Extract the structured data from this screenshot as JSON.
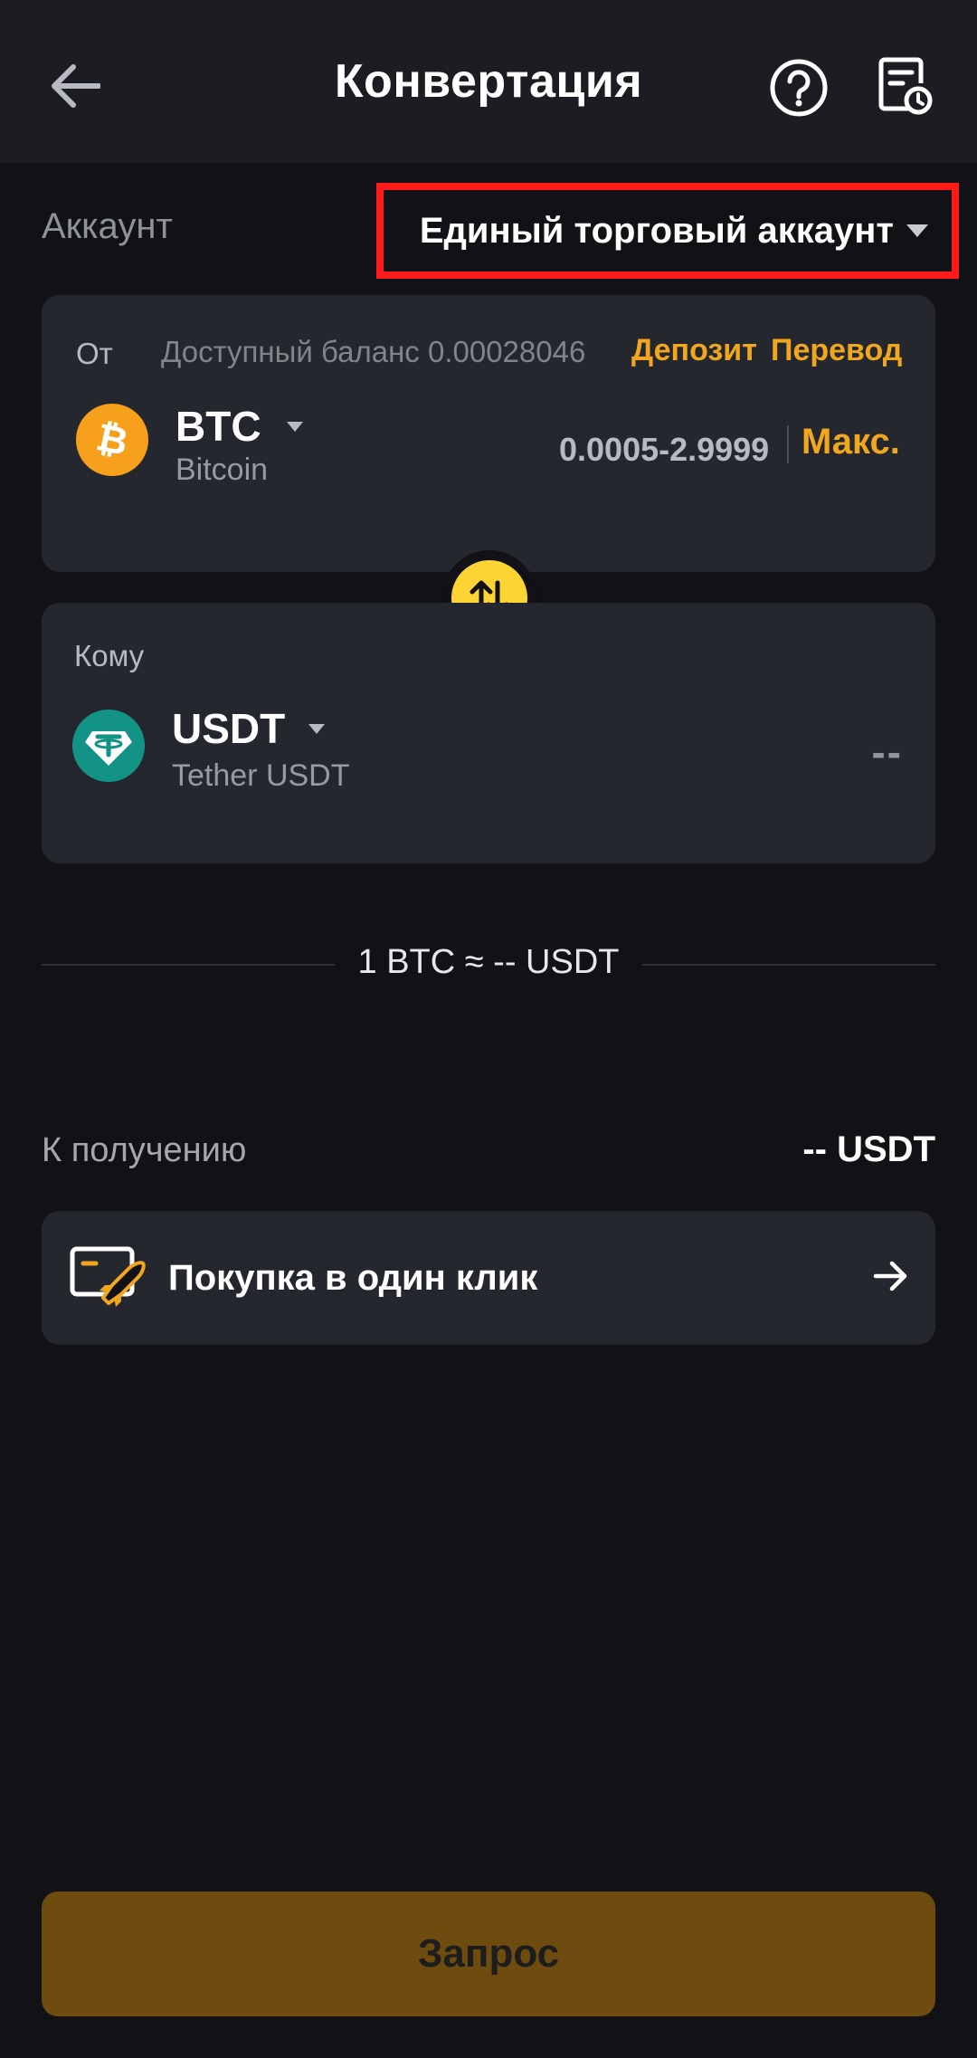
{
  "header": {
    "title": "Конвертация",
    "back_icon": "arrow-left-icon",
    "help_icon": "question-circle-icon",
    "history_icon": "document-clock-icon"
  },
  "account": {
    "label": "Аккаунт",
    "selected": "Единый торговый аккаунт"
  },
  "from": {
    "label": "От",
    "balance_text": "Доступный баланс 0.00028046",
    "deposit_label": "Депозит",
    "transfer_label": "Перевод",
    "coin_symbol": "BTC",
    "coin_name": "Bitcoin",
    "range": "0.0005-2.9999",
    "max_label": "Макс."
  },
  "to": {
    "label": "Кому",
    "coin_symbol": "USDT",
    "coin_name": "Tether USDT",
    "amount": "--"
  },
  "rate": {
    "text": "1 BTC ≈ -- USDT"
  },
  "receive": {
    "label": "К получению",
    "value": "-- USDT"
  },
  "one_click": {
    "label": "Покупка в один клик"
  },
  "request_button": {
    "label": "Запрос"
  },
  "colors": {
    "accent": "#f0a71f",
    "highlight_border": "#ff1a1a",
    "background": "#111116",
    "card": "#25272e"
  }
}
